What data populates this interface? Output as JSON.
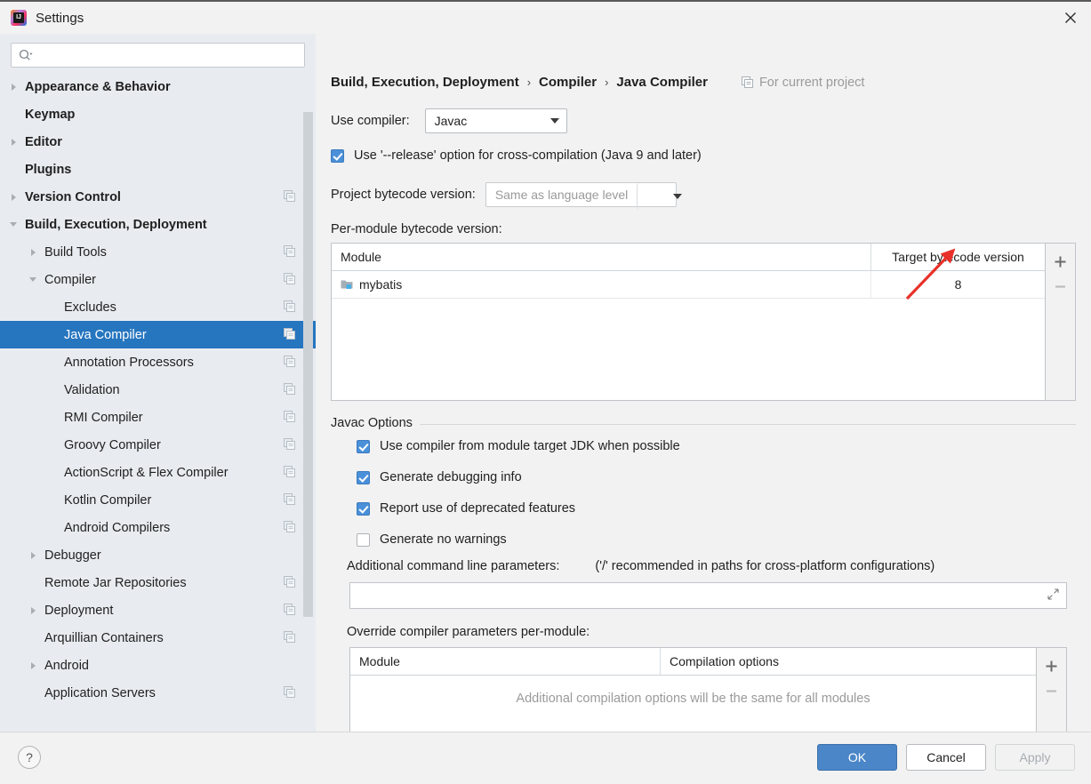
{
  "window": {
    "title": "Settings",
    "logo_text": "IJ",
    "close_icon": "close-icon"
  },
  "sidebar": {
    "search": {
      "value": "",
      "placeholder": "",
      "icon": "search-icon"
    },
    "items": [
      {
        "label": "Appearance & Behavior",
        "indent": 0,
        "arrow": "collapsed",
        "bold": true,
        "copy": false,
        "selected": false
      },
      {
        "label": "Keymap",
        "indent": 0,
        "arrow": "none",
        "bold": true,
        "copy": false,
        "selected": false
      },
      {
        "label": "Editor",
        "indent": 0,
        "arrow": "collapsed",
        "bold": true,
        "copy": false,
        "selected": false
      },
      {
        "label": "Plugins",
        "indent": 0,
        "arrow": "none",
        "bold": true,
        "copy": false,
        "selected": false
      },
      {
        "label": "Version Control",
        "indent": 0,
        "arrow": "collapsed",
        "bold": true,
        "copy": true,
        "selected": false
      },
      {
        "label": "Build, Execution, Deployment",
        "indent": 0,
        "arrow": "expanded",
        "bold": true,
        "copy": false,
        "selected": false
      },
      {
        "label": "Build Tools",
        "indent": 1,
        "arrow": "collapsed",
        "bold": false,
        "copy": true,
        "selected": false
      },
      {
        "label": "Compiler",
        "indent": 1,
        "arrow": "expanded",
        "bold": false,
        "copy": true,
        "selected": false
      },
      {
        "label": "Excludes",
        "indent": 2,
        "arrow": "none",
        "bold": false,
        "copy": true,
        "selected": false
      },
      {
        "label": "Java Compiler",
        "indent": 2,
        "arrow": "none",
        "bold": false,
        "copy": true,
        "selected": true
      },
      {
        "label": "Annotation Processors",
        "indent": 2,
        "arrow": "none",
        "bold": false,
        "copy": true,
        "selected": false
      },
      {
        "label": "Validation",
        "indent": 2,
        "arrow": "none",
        "bold": false,
        "copy": true,
        "selected": false
      },
      {
        "label": "RMI Compiler",
        "indent": 2,
        "arrow": "none",
        "bold": false,
        "copy": true,
        "selected": false
      },
      {
        "label": "Groovy Compiler",
        "indent": 2,
        "arrow": "none",
        "bold": false,
        "copy": true,
        "selected": false
      },
      {
        "label": "ActionScript & Flex Compiler",
        "indent": 2,
        "arrow": "none",
        "bold": false,
        "copy": true,
        "selected": false
      },
      {
        "label": "Kotlin Compiler",
        "indent": 2,
        "arrow": "none",
        "bold": false,
        "copy": true,
        "selected": false
      },
      {
        "label": "Android Compilers",
        "indent": 2,
        "arrow": "none",
        "bold": false,
        "copy": true,
        "selected": false
      },
      {
        "label": "Debugger",
        "indent": 1,
        "arrow": "collapsed",
        "bold": false,
        "copy": false,
        "selected": false
      },
      {
        "label": "Remote Jar Repositories",
        "indent": 1,
        "arrow": "none",
        "bold": false,
        "copy": true,
        "selected": false
      },
      {
        "label": "Deployment",
        "indent": 1,
        "arrow": "collapsed",
        "bold": false,
        "copy": true,
        "selected": false
      },
      {
        "label": "Arquillian Containers",
        "indent": 1,
        "arrow": "none",
        "bold": false,
        "copy": true,
        "selected": false
      },
      {
        "label": "Android",
        "indent": 1,
        "arrow": "collapsed",
        "bold": false,
        "copy": false,
        "selected": false
      },
      {
        "label": "Application Servers",
        "indent": 1,
        "arrow": "none",
        "bold": false,
        "copy": true,
        "selected": false
      }
    ]
  },
  "breadcrumb": {
    "crumbs": [
      "Build, Execution, Deployment",
      "Compiler",
      "Java Compiler"
    ],
    "separator": "›",
    "scope_label": "For current project",
    "scope_icon": "copy-scope-icon"
  },
  "main": {
    "use_compiler_label": "Use compiler:",
    "use_compiler_value": "Javac",
    "release_option": {
      "label": "Use '--release' option for cross-compilation (Java 9 and later)",
      "checked": true
    },
    "project_bytecode_label": "Project bytecode version:",
    "project_bytecode_value": "Same as language level",
    "per_module_label": "Per-module bytecode version:",
    "bytecode_table": {
      "headers": [
        "Module",
        "Target bytecode version"
      ],
      "rows": [
        {
          "module": "mybatis",
          "version": "8"
        }
      ],
      "add_label": "+",
      "remove_label": "−"
    },
    "javac_options": {
      "legend": "Javac Options",
      "checkboxes": [
        {
          "label": "Use compiler from module target JDK when possible",
          "checked": true
        },
        {
          "label": "Generate debugging info",
          "checked": true
        },
        {
          "label": "Report use of deprecated features",
          "checked": true
        },
        {
          "label": "Generate no warnings",
          "checked": false
        }
      ],
      "additional_label": "Additional command line parameters:",
      "additional_hint": "('/' recommended in paths for cross-platform configurations)",
      "additional_value": "",
      "override_label": "Override compiler parameters per-module:",
      "override_table": {
        "headers": [
          "Module",
          "Compilation options"
        ],
        "empty_message": "Additional compilation options will be the same for all modules",
        "add_label": "+",
        "remove_label": "−"
      }
    }
  },
  "footer": {
    "help_label": "?",
    "ok_label": "OK",
    "cancel_label": "Cancel",
    "apply_label": "Apply"
  },
  "annotation": {
    "type": "red-arrow",
    "color": "#e8312a",
    "from": [
      1020,
      334
    ],
    "to": [
      1069,
      283
    ]
  },
  "colors": {
    "selection": "#2675bf",
    "sidebar_bg": "#e8ecf0",
    "panel_bg": "#f2f2f2",
    "accent_checkbox": "#4a90d9",
    "primary_button": "#4a86c8",
    "annotation_red": "#e8312a"
  }
}
